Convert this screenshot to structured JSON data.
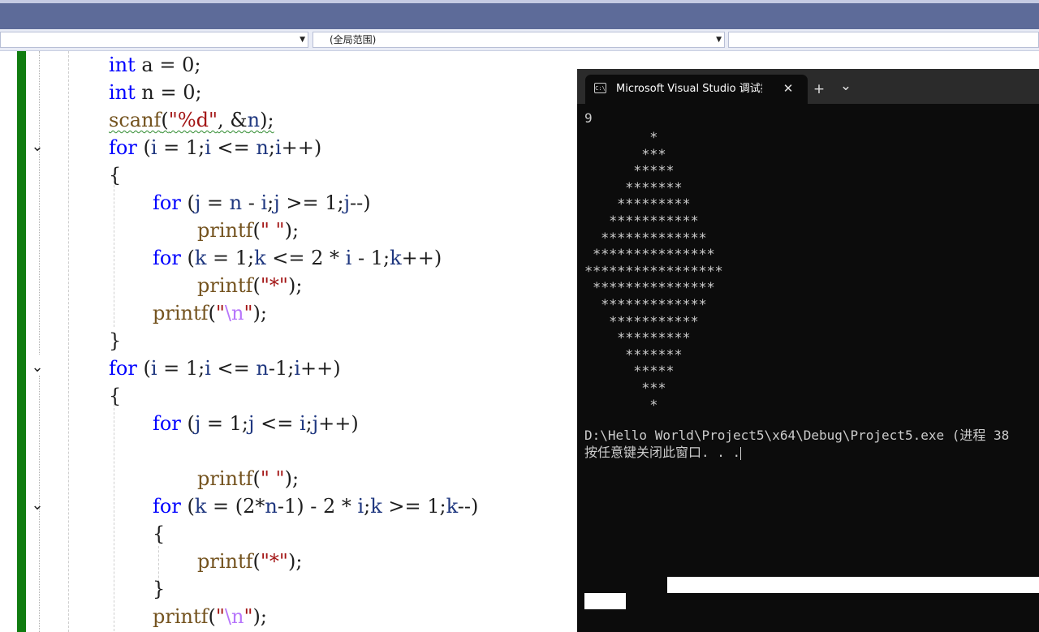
{
  "navbar": {
    "scope_dropdown": "(全局范围)"
  },
  "code": {
    "lines": {
      "l1": {
        "kw": "int",
        "rest": " a = 0;"
      },
      "l2": {
        "kw": "int",
        "rest": " n = 0;"
      },
      "l3": {
        "fn": "scanf",
        "p1": "(",
        "str": "\"%d\"",
        "p2": ", &",
        "var": "n",
        "p3": ");"
      },
      "l4": {
        "kw": "for",
        "p1": " (",
        "v1": "i",
        "p2": " = 1;",
        "v2": "i",
        "p3": " <= ",
        "v3": "n",
        "p4": ";",
        "v4": "i",
        "p5": "++)"
      },
      "l5": {
        "text": "{"
      },
      "l6": {
        "kw": "for",
        "p1": " (",
        "v1": "j",
        "p2": " = ",
        "v2": "n",
        "p3": " - ",
        "v3": "i",
        "p4": ";",
        "v4": "j",
        "p5": " >= 1;",
        "v5": "j",
        "p6": "--)"
      },
      "l7": {
        "fn": "printf",
        "p1": "(",
        "str": "\" \"",
        "p2": ");"
      },
      "l8": {
        "kw": "for",
        "p1": " (",
        "v1": "k",
        "p2": " = 1;",
        "v2": "k",
        "p3": " <= 2 * ",
        "v3": "i",
        "p4": " - 1;",
        "v4": "k",
        "p5": "++)"
      },
      "l9": {
        "fn": "printf",
        "p1": "(",
        "str": "\"*\"",
        "p2": ");"
      },
      "l10": {
        "fn": "printf",
        "p1": "(",
        "q1": "\"",
        "esc": "\\n",
        "q2": "\"",
        "p2": ");"
      },
      "l11": {
        "text": "}"
      },
      "l12": {
        "kw": "for",
        "p1": " (",
        "v1": "i",
        "p2": " = 1;",
        "v2": "i",
        "p3": " <= ",
        "v3": "n",
        "p4": "-1;",
        "v4": "i",
        "p5": "++)"
      },
      "l13": {
        "text": "{"
      },
      "l14": {
        "kw": "for",
        "p1": " (",
        "v1": "j",
        "p2": " = 1;",
        "v2": "j",
        "p3": " <= ",
        "v3": "i",
        "p4": ";",
        "v4": "j",
        "p5": "++)"
      },
      "l15": {
        "fn": "printf",
        "p1": "(",
        "str": "\" \"",
        "p2": ");"
      },
      "l16": {
        "kw": "for",
        "p1": " (",
        "v1": "k",
        "p2": " = (2*",
        "v2": "n",
        "p3": "-1) - 2 * ",
        "v3": "i",
        "p4": ";",
        "v4": "k",
        "p5": " >= 1;",
        "v5": "k",
        "p6": "--)"
      },
      "l17": {
        "text": "{"
      },
      "l18": {
        "fn": "printf",
        "p1": "(",
        "str": "\"*\"",
        "p2": ");"
      },
      "l19": {
        "text": "}"
      },
      "l20": {
        "fn": "printf",
        "p1": "(",
        "q1": "\"",
        "esc": "\\n",
        "q2": "\"",
        "p2": ");"
      }
    }
  },
  "console": {
    "tab_title": "Microsoft Visual Studio 调试控制台",
    "tab_icon_glyph": "C:\\",
    "close_glyph": "✕",
    "new_tab_glyph": "+",
    "dropdown_glyph": "⌄",
    "input_value": "9",
    "output_rows": [
      "        *",
      "       ***",
      "      *****",
      "     *******",
      "    *********",
      "   ***********",
      "  *************",
      " ***************",
      "*****************",
      " ***************",
      "  *************",
      "   ***********",
      "    *********",
      "     *******",
      "      *****",
      "       ***",
      "        *"
    ],
    "exit_line": "D:\\Hello World\\Project5\\x64\\Debug\\Project5.exe (进程 38",
    "press_key_line": "按任意键关闭此窗口. . ."
  }
}
